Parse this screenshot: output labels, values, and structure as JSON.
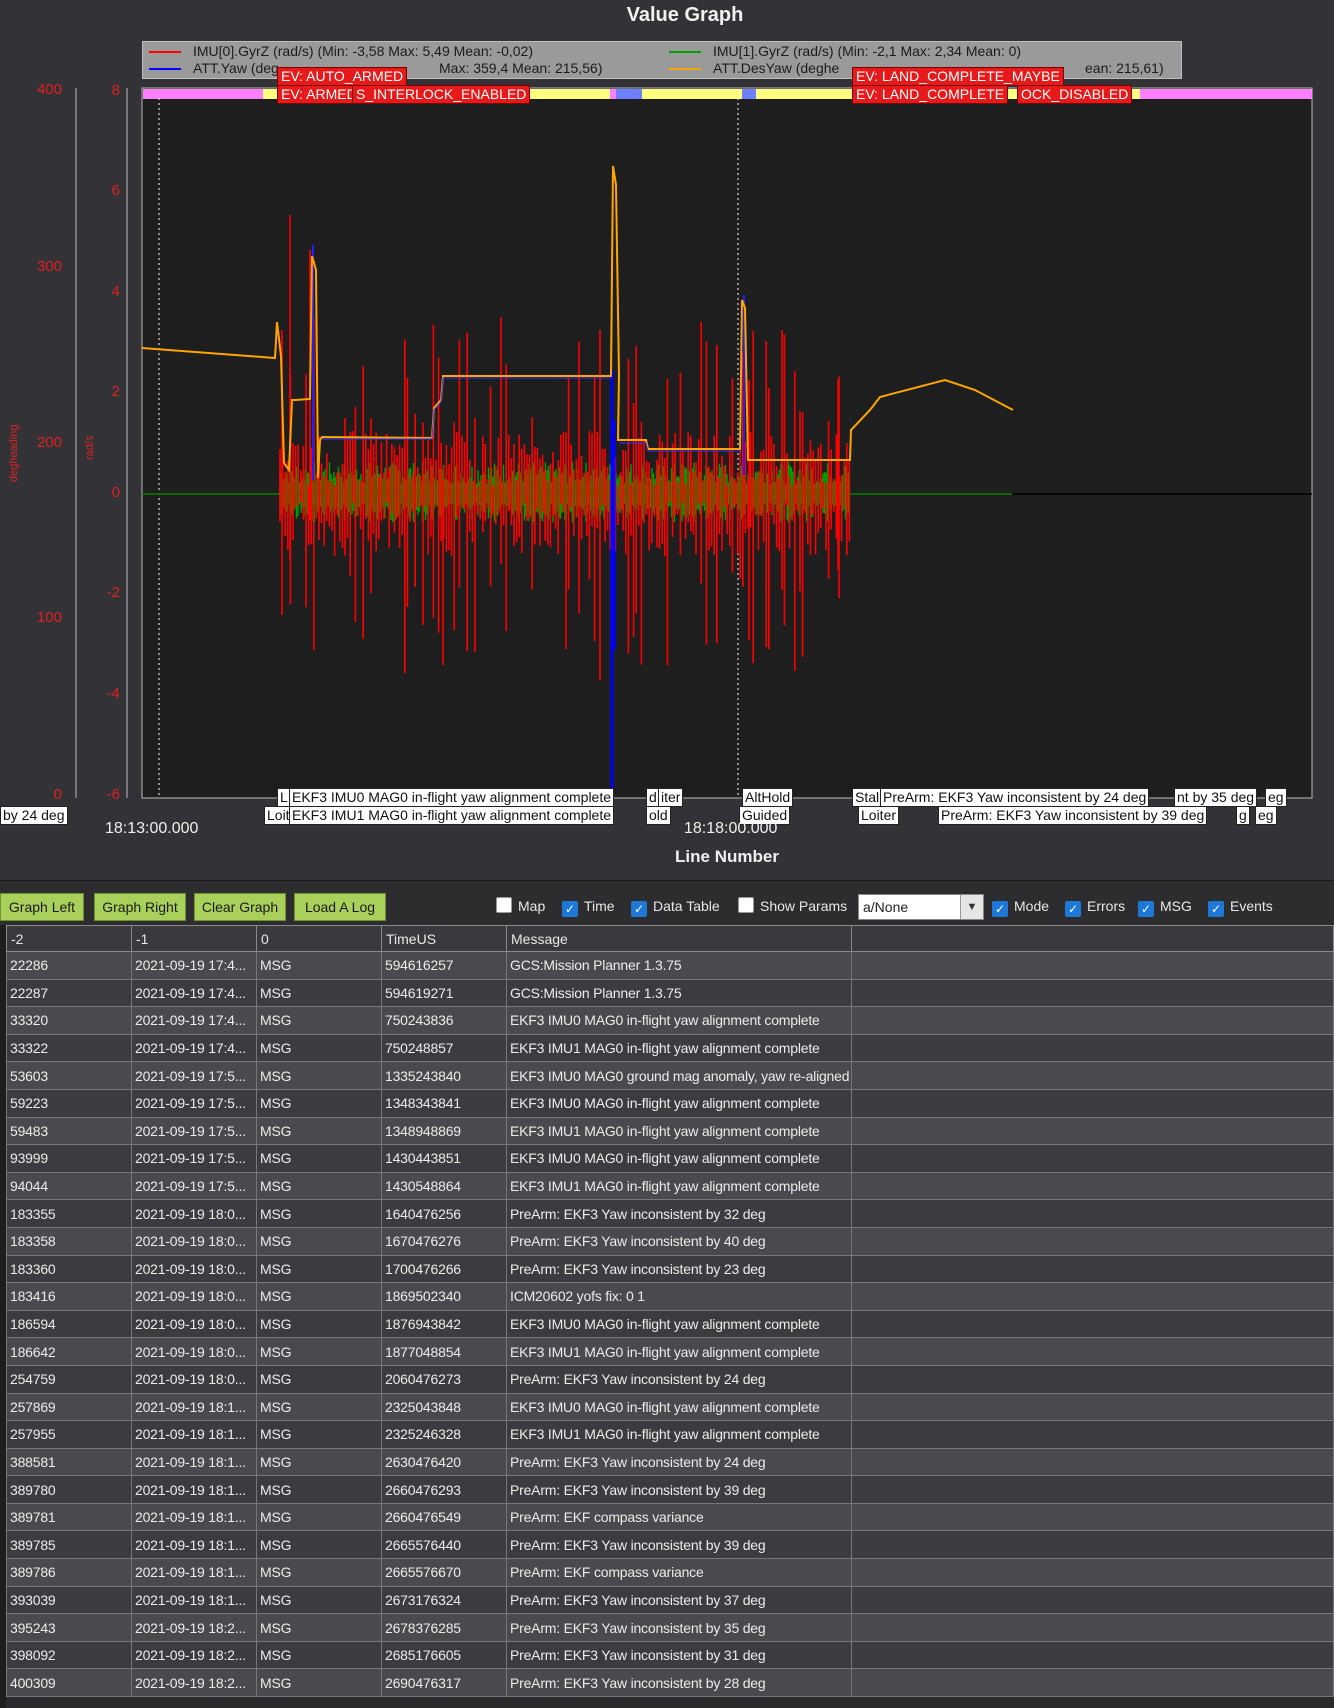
{
  "graph": {
    "title": "Value Graph",
    "x_axis_title": "Line Number",
    "left_axis_label": "degheading",
    "right_axis_label": "rad/s",
    "left_ticks": [
      "400",
      "300",
      "200",
      "100",
      "0"
    ],
    "right_ticks": [
      "8",
      "6",
      "4",
      "2",
      "0",
      "-2",
      "-4",
      "-6"
    ],
    "x_ticks": [
      "18:13:00.000",
      "18:18:00.000"
    ],
    "legend": [
      {
        "text": "IMU[0].GyrZ (rad/s) (Min: -3,58 Max: 5,49 Mean: -0,02)",
        "color": "#ff0000"
      },
      {
        "text": "IMU[1].GyrZ (rad/s) (Min: -2,1 Max: 2,34 Mean: 0)",
        "color": "#00a000"
      },
      {
        "text": "ATT.Yaw (deg",
        "tail": " Max: 359,4 Mean: 215,56)",
        "color": "#0000ff"
      },
      {
        "text": "ATT.DesYaw (deghe",
        "tail": "ean: 215,61)",
        "color": "#ffa500"
      }
    ],
    "events": [
      {
        "text": "EV: AUTO_ARMED"
      },
      {
        "text": "EV: ARMED"
      },
      {
        "text": "S_INTERLOCK_ENABLED"
      },
      {
        "text": "EV: LAND_COMPLETE_MAYBE"
      },
      {
        "text": "EV: LAND_COMPLETE"
      },
      {
        "text": "OCK_DISABLED"
      }
    ],
    "bottom_messages": [
      {
        "text": "by 24 deg"
      },
      {
        "text": "L"
      },
      {
        "text": "EKF3 IMU0 MAG0 in-flight yaw alignment complete"
      },
      {
        "text": "d"
      },
      {
        "text": "iter"
      },
      {
        "text": "Loit"
      },
      {
        "text": "EKF3 IMU1 MAG0 in-flight yaw alignment complete"
      },
      {
        "text": "old"
      },
      {
        "text": "AltHold"
      },
      {
        "text": "Guided"
      },
      {
        "text": "Stal"
      },
      {
        "text": "PreArm: EKF3 Yaw inconsistent by 24 deg"
      },
      {
        "text": "nt by 35 deg"
      },
      {
        "text": "eg"
      },
      {
        "text": "Loiter"
      },
      {
        "text": "PreArm: EKF3 Yaw inconsistent by 39 deg"
      },
      {
        "text": "g"
      },
      {
        "text": "eg"
      }
    ],
    "colors": {
      "mode_pink": "#ff80ff",
      "mode_yellow": "#ffff80",
      "mode_blue": "#6e7fff"
    }
  },
  "toolbar": {
    "graph_left": "Graph Left",
    "graph_right": "Graph Right",
    "clear_graph": "Clear Graph",
    "load_log": "Load A Log",
    "checks": [
      {
        "label": "Map",
        "checked": false
      },
      {
        "label": "Time",
        "checked": true
      },
      {
        "label": "Data Table",
        "checked": true
      },
      {
        "label": "Show Params",
        "checked": false
      },
      {
        "label": "Mode",
        "checked": true
      },
      {
        "label": "Errors",
        "checked": true
      },
      {
        "label": "MSG",
        "checked": true
      },
      {
        "label": "Events",
        "checked": true
      }
    ],
    "select_value": "a/None"
  },
  "table": {
    "headers": [
      "-2",
      "-1",
      "0",
      "TimeUS",
      "Message",
      ""
    ],
    "rows": [
      [
        "22286",
        "2021-09-19 17:4...",
        "MSG",
        "594616257",
        "GCS:Mission Planner 1.3.75"
      ],
      [
        "22287",
        "2021-09-19 17:4...",
        "MSG",
        "594619271",
        "GCS:Mission Planner 1.3.75"
      ],
      [
        "33320",
        "2021-09-19 17:4...",
        "MSG",
        "750243836",
        "EKF3 IMU0 MAG0 in-flight yaw alignment complete"
      ],
      [
        "33322",
        "2021-09-19 17:4...",
        "MSG",
        "750248857",
        "EKF3 IMU1 MAG0 in-flight yaw alignment complete"
      ],
      [
        "53603",
        "2021-09-19 17:5...",
        "MSG",
        "1335243840",
        "EKF3 IMU0 MAG0 ground mag anomaly, yaw re-aligned"
      ],
      [
        "59223",
        "2021-09-19 17:5...",
        "MSG",
        "1348343841",
        "EKF3 IMU0 MAG0 in-flight yaw alignment complete"
      ],
      [
        "59483",
        "2021-09-19 17:5...",
        "MSG",
        "1348948869",
        "EKF3 IMU1 MAG0 in-flight yaw alignment complete"
      ],
      [
        "93999",
        "2021-09-19 17:5...",
        "MSG",
        "1430443851",
        "EKF3 IMU0 MAG0 in-flight yaw alignment complete"
      ],
      [
        "94044",
        "2021-09-19 17:5...",
        "MSG",
        "1430548864",
        "EKF3 IMU1 MAG0 in-flight yaw alignment complete"
      ],
      [
        "183355",
        "2021-09-19 18:0...",
        "MSG",
        "1640476256",
        "PreArm: EKF3 Yaw inconsistent by 32 deg"
      ],
      [
        "183358",
        "2021-09-19 18:0...",
        "MSG",
        "1670476276",
        "PreArm: EKF3 Yaw inconsistent by 40 deg"
      ],
      [
        "183360",
        "2021-09-19 18:0...",
        "MSG",
        "1700476266",
        "PreArm: EKF3 Yaw inconsistent by 23 deg"
      ],
      [
        "183416",
        "2021-09-19 18:0...",
        "MSG",
        "1869502340",
        "ICM20602 yofs fix: 0 1"
      ],
      [
        "186594",
        "2021-09-19 18:0...",
        "MSG",
        "1876943842",
        "EKF3 IMU0 MAG0 in-flight yaw alignment complete"
      ],
      [
        "186642",
        "2021-09-19 18:0...",
        "MSG",
        "1877048854",
        "EKF3 IMU1 MAG0 in-flight yaw alignment complete"
      ],
      [
        "254759",
        "2021-09-19 18:0...",
        "MSG",
        "2060476273",
        "PreArm: EKF3 Yaw inconsistent by 24 deg"
      ],
      [
        "257869",
        "2021-09-19 18:1...",
        "MSG",
        "2325043848",
        "EKF3 IMU0 MAG0 in-flight yaw alignment complete"
      ],
      [
        "257955",
        "2021-09-19 18:1...",
        "MSG",
        "2325246328",
        "EKF3 IMU1 MAG0 in-flight yaw alignment complete"
      ],
      [
        "388581",
        "2021-09-19 18:1...",
        "MSG",
        "2630476420",
        "PreArm: EKF3 Yaw inconsistent by 24 deg"
      ],
      [
        "389780",
        "2021-09-19 18:1...",
        "MSG",
        "2660476293",
        "PreArm: EKF3 Yaw inconsistent by 39 deg"
      ],
      [
        "389781",
        "2021-09-19 18:1...",
        "MSG",
        "2660476549",
        "PreArm: EKF compass variance"
      ],
      [
        "389785",
        "2021-09-19 18:1...",
        "MSG",
        "2665576440",
        "PreArm: EKF3 Yaw inconsistent by 39 deg"
      ],
      [
        "389786",
        "2021-09-19 18:1...",
        "MSG",
        "2665576670",
        "PreArm: EKF compass variance"
      ],
      [
        "393039",
        "2021-09-19 18:1...",
        "MSG",
        "2673176324",
        "PreArm: EKF3 Yaw inconsistent by 37 deg"
      ],
      [
        "395243",
        "2021-09-19 18:2...",
        "MSG",
        "2678376285",
        "PreArm: EKF3 Yaw inconsistent by 35 deg"
      ],
      [
        "398092",
        "2021-09-19 18:2...",
        "MSG",
        "2685176605",
        "PreArm: EKF3 Yaw inconsistent by 31 deg"
      ],
      [
        "400309",
        "2021-09-19 18:2...",
        "MSG",
        "2690476317",
        "PreArm: EKF3 Yaw inconsistent by 28 deg"
      ]
    ]
  }
}
